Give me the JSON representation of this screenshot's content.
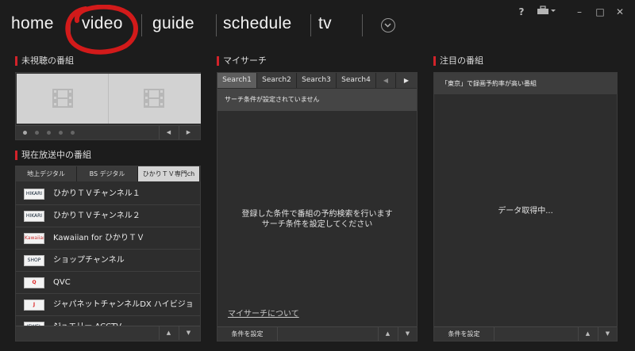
{
  "nav": {
    "items": [
      "home",
      "video",
      "guide",
      "schedule",
      "tv"
    ],
    "help": "?",
    "toolbox_icon": "toolbox-icon",
    "minimize": "–",
    "maximize": "□",
    "close": "✕"
  },
  "unwatched": {
    "title": "未視聴の番組",
    "thumb_icon": "film-icon",
    "dot_count": 5,
    "prev": "◀",
    "next": "▶"
  },
  "onair": {
    "title": "現在放送中の番組",
    "tabs": [
      "地上デジタル",
      "BS デジタル",
      "ひかりＴＶ専門ch"
    ],
    "active_tab": 2,
    "channels": [
      {
        "name": "ひかりＴＶチャンネル１",
        "logo": "HIKARI TV"
      },
      {
        "name": "ひかりＴＶチャンネル２",
        "logo": "HIKARI TV"
      },
      {
        "name": "Kawaiian for ひかりＴＶ",
        "logo": "Kawaiian"
      },
      {
        "name": "ショップチャンネル",
        "logo": "SHOP"
      },
      {
        "name": "QVC",
        "logo": "Q"
      },
      {
        "name": "ジャパネットチャンネルDX ハイビジョン",
        "logo": "J"
      },
      {
        "name": "ジュエリー ACCTV",
        "logo": "JEWEL"
      }
    ],
    "up": "▲",
    "down": "▼"
  },
  "my_search": {
    "title": "マイサーチ",
    "tabs": [
      "Search1",
      "Search2",
      "Search3",
      "Search4"
    ],
    "active_tab": 0,
    "prev": "◀",
    "next": "▶",
    "status": "サーチ条件が設定されていません",
    "message_line1": "登録した条件で番組の予約検索を行います",
    "message_line2": "サーチ条件を設定してください",
    "link": "マイサーチについて",
    "button": "条件を設定",
    "up": "▲",
    "down": "▼"
  },
  "featured": {
    "title": "注目の番組",
    "header": "「東京」で録画予約率が高い番組",
    "loading": "データ取得中...",
    "button": "条件を設定",
    "up": "▲",
    "down": "▼"
  },
  "colors": {
    "background": "#1c1c1c",
    "panel": "#2d2d2d",
    "accent": "#d2232a"
  }
}
